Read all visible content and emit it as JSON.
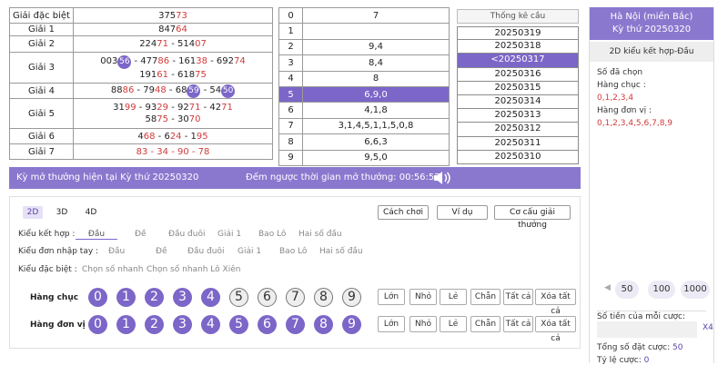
{
  "prizes": [
    {
      "name": "Giải đặc biệt",
      "lines": [
        [
          {
            "t": "375"
          },
          {
            "t": "73",
            "c": "red"
          }
        ]
      ]
    },
    {
      "name": "Giải 1",
      "lines": [
        [
          {
            "t": "847"
          },
          {
            "t": "64",
            "c": "red"
          }
        ]
      ]
    },
    {
      "name": "Giải 2",
      "lines": [
        [
          {
            "t": "224"
          },
          {
            "t": "71",
            "c": "red"
          },
          {
            "t": " - 514"
          },
          {
            "t": "07",
            "c": "red"
          }
        ]
      ]
    },
    {
      "name": "Giải 3",
      "lines": [
        [
          {
            "t": "003"
          },
          {
            "t": "56",
            "c": "ball"
          },
          {
            "t": " - 477"
          },
          {
            "t": "86",
            "c": "red"
          },
          {
            "t": " - 161"
          },
          {
            "t": "38",
            "c": "red"
          },
          {
            "t": " - 692"
          },
          {
            "t": "74",
            "c": "red"
          }
        ],
        [
          {
            "t": "191"
          },
          {
            "t": "61",
            "c": "red"
          },
          {
            "t": " - 618"
          },
          {
            "t": "75",
            "c": "red"
          }
        ]
      ]
    },
    {
      "name": "Giải 4",
      "lines": [
        [
          {
            "t": "88"
          },
          {
            "t": "86",
            "c": "red"
          },
          {
            "t": " - 79"
          },
          {
            "t": "48",
            "c": "red"
          },
          {
            "t": " - 68"
          },
          {
            "t": "59",
            "c": "ball"
          },
          {
            "t": " - 54"
          },
          {
            "t": "50",
            "c": "ball"
          }
        ]
      ]
    },
    {
      "name": "Giải 5",
      "lines": [
        [
          {
            "t": "31"
          },
          {
            "t": "99",
            "c": "red"
          },
          {
            "t": " - 93"
          },
          {
            "t": "29",
            "c": "red"
          },
          {
            "t": " - 92"
          },
          {
            "t": "71",
            "c": "red"
          },
          {
            "t": " - 42"
          },
          {
            "t": "71",
            "c": "red"
          }
        ],
        [
          {
            "t": "58"
          },
          {
            "t": "75",
            "c": "red"
          },
          {
            "t": " - 30"
          },
          {
            "t": "70",
            "c": "red"
          }
        ]
      ]
    },
    {
      "name": "Giải 6",
      "lines": [
        [
          {
            "t": "4"
          },
          {
            "t": "68",
            "c": "red"
          },
          {
            "t": " - 6"
          },
          {
            "t": "24",
            "c": "red"
          },
          {
            "t": " - 1"
          },
          {
            "t": "95",
            "c": "red"
          }
        ]
      ]
    },
    {
      "name": "Giải 7",
      "lines": [
        [
          {
            "t": "83 - 34 - 90 - 78",
            "c": "red"
          }
        ]
      ]
    }
  ],
  "loto": [
    {
      "head": "0",
      "tail": "7"
    },
    {
      "head": "1",
      "tail": ""
    },
    {
      "head": "2",
      "tail": "9,4"
    },
    {
      "head": "3",
      "tail": "8,4"
    },
    {
      "head": "4",
      "tail": "8"
    },
    {
      "head": "5",
      "tail": "6,9,0",
      "selected": true
    },
    {
      "head": "6",
      "tail": "4,1,8"
    },
    {
      "head": "7",
      "tail": "3,1,4,5,1,1,5,0,8"
    },
    {
      "head": "8",
      "tail": "6,6,3"
    },
    {
      "head": "9",
      "tail": "9,5,0"
    }
  ],
  "stats": {
    "title": "Thống kê cầu",
    "dates": [
      "20250319",
      "20250318",
      "<20250317",
      "20250316",
      "20250315",
      "20250314",
      "20250313",
      "20250312",
      "20250311",
      "20250310"
    ],
    "selected_index": 2
  },
  "info_bar": {
    "draw": "Kỳ mở thưởng hiện tại Kỳ thứ 20250320",
    "countdown": "Đếm ngược thời gian mở thưởng: 00:56:57"
  },
  "tabs": [
    "2D",
    "3D",
    "4D"
  ],
  "top_buttons": [
    "Cách chơi",
    "Ví dụ",
    "Cơ cấu giải thưởng"
  ],
  "rows": {
    "combo": {
      "label": "Kiểu kết hợp :",
      "options": [
        "Đầu",
        "Đề",
        "Đầu đuôi",
        "Giải 1",
        "Bao Lô",
        "Hai số đầu"
      ]
    },
    "manual": {
      "label": "Kiểu đơn nhập tay :",
      "options": [
        "Đầu",
        "Đề",
        "Đầu đuôi",
        "Giải 1",
        "Bao Lô",
        "Hai số đầu"
      ]
    },
    "special": {
      "label": "Kiểu đặc biệt :",
      "options": [
        "Chọn số nhanh",
        "Chọn số nhanh Lô Xiên"
      ]
    }
  },
  "ball_rows": [
    {
      "label": "Hàng chục",
      "selected": [
        0,
        1,
        2,
        3,
        4
      ]
    },
    {
      "label": "Hàng đơn vị",
      "selected": [
        0,
        1,
        2,
        3,
        4,
        5,
        6,
        7,
        8,
        9
      ]
    }
  ],
  "quick_buttons": [
    "Lớn",
    "Nhỏ",
    "Lẻ",
    "Chẵn",
    "Tất cả",
    "Xóa tất cả"
  ],
  "sidebar": {
    "region": "Hà Nội (miền Bắc)",
    "period": "Kỳ thứ 20250320",
    "mode": "2D kiểu kết hợp-Đầu",
    "picked_label": "Số đã chọn",
    "tens_label": "Hàng chục :",
    "tens_value": "0,1,2,3,4",
    "units_label": "Hàng đơn vị :",
    "units_value": "0,1,2,3,4,5,6,7,8,9",
    "chips": [
      "50",
      "100",
      "1000"
    ],
    "chip_prev": "◀",
    "amount_label": "Số tiền của mỗi cược:",
    "multiplier": "X4",
    "total_label": "Tổng số đặt cược:",
    "total_value": "50",
    "ratio_label": "Tỷ lệ cược:",
    "ratio_value": "0"
  },
  "colors": {
    "accent": "#7c66c8",
    "bar": "#8a78cf",
    "red": "#d23a3a"
  }
}
